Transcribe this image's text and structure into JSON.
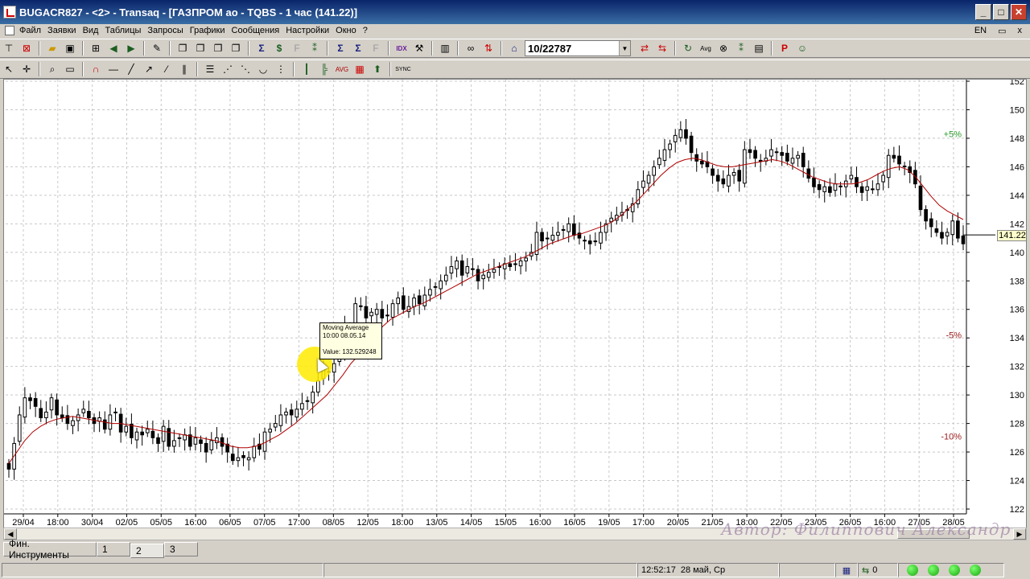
{
  "window": {
    "title": "BUGACR827 - <2> - Transaq - [ГАЗПРОМ ао - TQBS - 1 час (141.22)]",
    "min_icon": "minimize-icon",
    "max_icon": "maximize-icon",
    "close_icon": "close-icon"
  },
  "menu": {
    "items": [
      "Файл",
      "Заявки",
      "Вид",
      "Таблицы",
      "Запросы",
      "Графики",
      "Сообщения",
      "Настройки",
      "Окно",
      "?"
    ],
    "lang": "EN",
    "restore_glyph": "▭",
    "close_glyph": "x"
  },
  "toolbar": {
    "instrument_combo": "10/22787",
    "combo_arrow": "▼"
  },
  "chart": {
    "y_ticks": [
      "152",
      "150",
      "148",
      "146",
      "144",
      "142",
      "140",
      "138",
      "136",
      "134",
      "132",
      "130",
      "128",
      "126",
      "124",
      "122"
    ],
    "x_ticks": [
      "29/04",
      "18:00",
      "30/04",
      "02/05",
      "05/05",
      "16:00",
      "06/05",
      "07/05",
      "17:00",
      "08/05",
      "12/05",
      "18:00",
      "13/05",
      "14/05",
      "15/05",
      "16:00",
      "16/05",
      "19/05",
      "17:00",
      "20/05",
      "21/05",
      "18:00",
      "22/05",
      "23/05",
      "26/05",
      "16:00",
      "27/05",
      "28/05"
    ],
    "last_price": "141.22",
    "pct_plus5": "+5%",
    "pct_minus5": "-5%",
    "pct_minus10": "-10%",
    "tooltip": {
      "name": "Moving Average",
      "time": "10:00 08.05.14",
      "value": "Value: 132.529248"
    },
    "colors": {
      "candle": "#000000",
      "ma": "#b00000",
      "grid": "#c8c8c8",
      "pct_plus": "#2a9a2a",
      "pct_minus": "#a02020"
    }
  },
  "chart_data": {
    "type": "candlestick",
    "title": "ГАЗПРОМ ао - TQBS - 1 час",
    "ylim": [
      122,
      152
    ],
    "close_series": [
      124.8,
      126.6,
      128.6,
      129.8,
      129.6,
      129.2,
      128.4,
      128.8,
      129.8,
      128.6,
      128.4,
      128.0,
      128.2,
      128.6,
      129.0,
      128.4,
      128.0,
      128.4,
      127.6,
      128.6,
      128.8,
      127.4,
      127.8,
      127.0,
      127.4,
      127.2,
      127.6,
      127.0,
      126.6,
      127.8,
      126.4,
      126.8,
      127.0,
      127.2,
      126.4,
      127.0,
      126.6,
      126.0,
      126.8,
      127.0,
      126.4,
      126.0,
      125.4,
      125.6,
      125.6,
      125.6,
      126.4,
      126.2,
      127.4,
      127.6,
      128.0,
      128.6,
      128.8,
      128.6,
      129.0,
      129.4,
      129.6,
      130.2,
      131.0,
      131.8,
      131.6,
      132.2,
      133.0,
      134.8,
      134.0,
      136.4,
      136.2,
      135.4,
      135.8,
      136.0,
      135.4,
      135.6,
      136.4,
      136.8,
      136.0,
      136.2,
      136.8,
      136.4,
      137.0,
      137.4,
      137.6,
      138.0,
      138.4,
      139.0,
      139.4,
      138.4,
      139.0,
      138.8,
      138.0,
      138.4,
      138.6,
      138.8,
      139.0,
      139.2,
      139.0,
      139.2,
      139.4,
      139.6,
      140.0,
      141.4,
      140.8,
      141.0,
      141.2,
      141.4,
      141.6,
      142.0,
      141.2,
      141.0,
      140.8,
      140.6,
      140.8,
      141.4,
      142.0,
      142.4,
      142.6,
      142.8,
      143.0,
      143.4,
      144.4,
      145.0,
      145.4,
      146.0,
      146.6,
      147.2,
      147.6,
      148.2,
      148.6,
      148.0,
      147.0,
      146.4,
      146.2,
      146.0,
      145.4,
      145.0,
      144.8,
      145.4,
      145.6,
      145.0,
      147.2,
      147.0,
      146.6,
      146.4,
      146.6,
      147.2,
      147.0,
      146.8,
      146.4,
      146.6,
      146.8,
      146.0,
      145.2,
      144.6,
      144.4,
      144.6,
      144.2,
      144.8,
      144.6,
      145.0,
      145.4,
      144.6,
      144.2,
      144.6,
      144.4,
      144.8,
      145.4,
      146.8,
      146.6,
      146.2,
      146.0,
      145.6,
      144.8,
      143.0,
      142.2,
      141.8,
      141.4,
      141.0,
      141.4,
      142.2,
      141.0,
      140.6
    ],
    "ma_series": [
      125.2,
      126.0,
      126.8,
      127.4,
      127.8,
      128.1,
      128.3,
      128.4,
      128.5,
      128.4,
      128.3,
      128.2,
      128.1,
      128.0,
      128.0,
      127.9,
      127.8,
      127.7,
      127.6,
      127.5,
      127.4,
      127.3,
      127.2,
      127.1,
      127.0,
      126.9,
      126.8,
      126.6,
      126.4,
      126.3,
      126.3,
      126.4,
      126.6,
      126.9,
      127.2,
      127.6,
      128.0,
      128.5,
      129.0,
      129.5,
      130.0,
      130.7,
      131.4,
      132.2,
      132.8,
      133.5,
      134.2,
      134.8,
      135.3,
      135.6,
      135.9,
      136.2,
      136.4,
      136.7,
      137.0,
      137.3,
      137.6,
      137.9,
      138.2,
      138.5,
      138.7,
      138.9,
      139.1,
      139.3,
      139.5,
      139.7,
      140.0,
      140.3,
      140.6,
      140.8,
      141.0,
      141.2,
      141.3,
      141.5,
      141.7,
      141.9,
      142.2,
      142.6,
      143.1,
      143.6,
      144.2,
      144.8,
      145.4,
      145.9,
      146.3,
      146.5,
      146.6,
      146.5,
      146.3,
      146.1,
      146.0,
      146.0,
      146.1,
      146.2,
      146.3,
      146.4,
      146.5,
      146.4,
      146.2,
      145.9,
      145.6,
      145.3,
      145.1,
      144.9,
      144.8,
      144.8,
      144.8,
      144.9,
      145.1,
      145.4,
      145.7,
      145.9,
      146.0,
      145.8,
      145.3,
      144.6,
      143.9,
      143.3,
      142.9,
      142.6,
      142.3
    ]
  },
  "footer": {
    "author": "Автор: Филиппович Александр",
    "tabs": [
      "Фин. Инструменты",
      "1",
      "2",
      "3"
    ],
    "status_time": "12:52:17",
    "status_date": "28 май, Ср",
    "conn_count": "0"
  }
}
